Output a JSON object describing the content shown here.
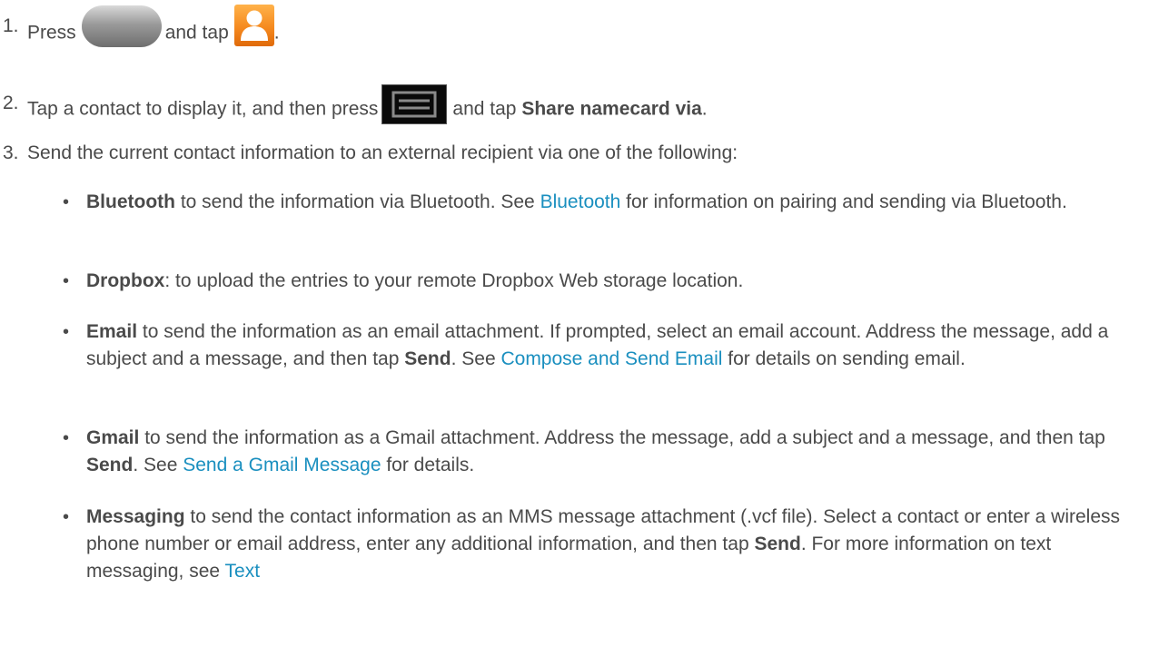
{
  "steps": [
    {
      "number": "1.",
      "press": "Press",
      "and_tap": "and tap",
      "end": ".",
      "icons": [
        "home-key-icon",
        "contacts-app-icon"
      ]
    },
    {
      "number": "2.",
      "text_before": "Tap a contact to display it, and then press",
      "text_mid": "and tap",
      "bold": "Share namecard via",
      "end": ".",
      "icons": [
        "menu-key-icon"
      ]
    },
    {
      "number": "3.",
      "text": "Send the current contact information to an external recipient via one of the following:"
    }
  ],
  "bullets": [
    {
      "bold": "Bluetooth",
      "text1": " to send the information via Bluetooth. See ",
      "link": "Bluetooth",
      "text2": " for information on pairing and sending via Bluetooth."
    },
    {
      "bold": "Dropbox",
      "text1": ": to upload the entries to your remote Dropbox Web storage location."
    },
    {
      "bold": "Email",
      "text1": " to send the information as an email attachment. If prompted, select an email account. Address the message, add a subject and a message, and then tap ",
      "bold2": "Send",
      "text2": ". See ",
      "link": "Compose and Send Email",
      "text3": " for details on sending email."
    },
    {
      "bold": "Gmail",
      "text1": " to send the information as a Gmail attachment. Address the message, add a subject and a message, and then tap ",
      "bold2": "Send",
      "text2": ". See ",
      "link": "Send a Gmail Message",
      "text3": " for details."
    },
    {
      "bold": "Messaging",
      "text1": " to send the contact information as an MMS message attachment (.vcf file). Select a contact or enter a wireless phone number or email address, enter any additional information, and then tap ",
      "bold2": "Send",
      "text2": ". For more information on text messaging, see ",
      "link": "Text"
    }
  ],
  "bullet_symbol": "•",
  "colors": {
    "text": "#4a4a4a",
    "link": "#1a8fbf",
    "contacts_icon": "#f58a1f"
  }
}
